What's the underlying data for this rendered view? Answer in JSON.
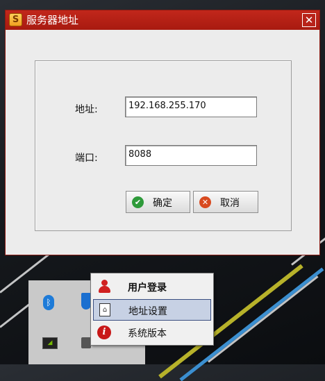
{
  "dialog": {
    "title": "服务器地址",
    "close_label": "✕"
  },
  "form": {
    "address_label": "地址:",
    "address_value": "192.168.255.170",
    "port_label": "端口:",
    "port_value": "8088"
  },
  "buttons": {
    "ok_label": "确定",
    "cancel_label": "取消"
  },
  "menu": {
    "items": [
      {
        "label": "用户登录",
        "icon": "user-icon",
        "selected": false
      },
      {
        "label": "地址设置",
        "icon": "address-doc-icon",
        "selected": true
      },
      {
        "label": "系统版本",
        "icon": "info-icon",
        "selected": false
      }
    ]
  },
  "colors": {
    "titlebar": "#b8231a",
    "dialog_bg": "#ececec",
    "menu_selected": "#c7d1e4",
    "ok_icon": "#2e9a3a",
    "cancel_icon": "#d84a20"
  },
  "tray_icons": [
    "bluetooth-icon",
    "shield-icon",
    "nvidia-icon",
    "lock-icon"
  ]
}
